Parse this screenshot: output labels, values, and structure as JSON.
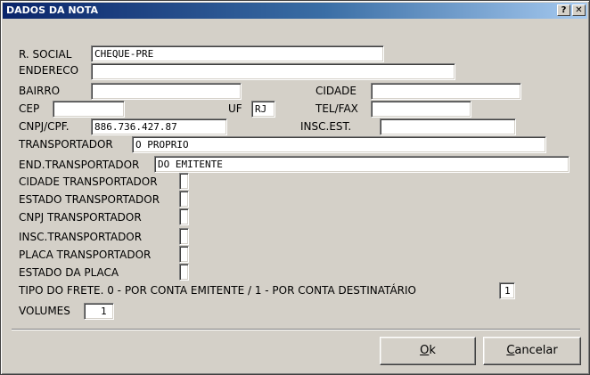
{
  "window": {
    "title": "DADOS DA NOTA",
    "help_button": "?",
    "close_button": "✕"
  },
  "labels": {
    "razao_social": "R. SOCIAL",
    "endereco": "ENDERECO",
    "bairro": "BAIRRO",
    "cidade": "CIDADE",
    "cep": "CEP",
    "uf": "UF",
    "tel_fax": "TEL/FAX",
    "cnpj_cpf": "CNPJ/CPF.",
    "insc_est": "INSC.EST.",
    "transportador": "TRANSPORTADOR",
    "end_transportador": "END.TRANSPORTADOR",
    "cidade_transportador": "CIDADE TRANSPORTADOR",
    "estado_transportador": "ESTADO TRANSPORTADOR",
    "cnpj_transportador": "CNPJ TRANSPORTADOR",
    "insc_transportador": "INSC.TRANSPORTADOR",
    "placa_transportador": "PLACA TRANSPORTADOR",
    "estado_placa": "ESTADO DA PLACA",
    "tipo_frete": "TIPO DO FRETE. 0 - POR CONTA EMITENTE / 1 - POR CONTA DESTINATÁRIO",
    "volumes": "VOLUMES"
  },
  "values": {
    "razao_social": "CHEQUE-PRE",
    "endereco": "",
    "bairro": "",
    "cidade": "",
    "cep": "",
    "uf": "RJ",
    "tel_fax": "",
    "cnpj_cpf": "886.736.427.87",
    "insc_est": "",
    "transportador": "O PROPRIO",
    "end_transportador": "DO EMITENTE",
    "cidade_transportador": "",
    "estado_transportador": "",
    "cnpj_transportador": "",
    "insc_transportador": "",
    "placa_transportador": "",
    "estado_placa": "",
    "tipo_frete": "1",
    "volumes": "1"
  },
  "buttons": {
    "ok_mnemonic": "O",
    "ok_rest": "k",
    "cancel_mnemonic": "C",
    "cancel_rest": "ancelar"
  }
}
